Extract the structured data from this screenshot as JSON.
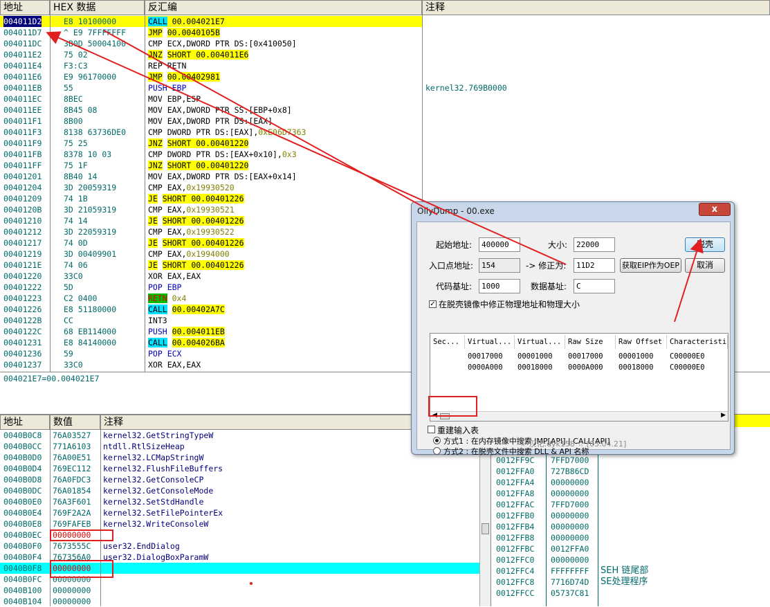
{
  "cpu": {
    "headers": {
      "addr": "地址",
      "hex": "HEX 数据",
      "dis": "反汇编",
      "cmt": "注释"
    },
    "rows": [
      {
        "addr": "004011D2",
        "hex": "E8 10100000",
        "op": "CALL",
        "opt": "call",
        "arg": "00.004021E7",
        "argt": "y",
        "cmt": ""
      },
      {
        "addr": "004011D7",
        "hex": "^ E9 7FFFFFFF",
        "op": "JMP",
        "opt": "red",
        "arg": "00.0040105B",
        "argt": "y",
        "cmt": ""
      },
      {
        "addr": "004011DC",
        "hex": "3B0D 50004100",
        "op": "CMP ECX,DWORD PTR DS:[0x410050]",
        "opt": "plain",
        "arg": "",
        "argt": "",
        "cmt": ""
      },
      {
        "addr": "004011E2",
        "hex": "75 02",
        "op": "JNZ",
        "opt": "red",
        "arg": "SHORT 00.004011E6",
        "argt": "y",
        "cmt": ""
      },
      {
        "addr": "004011E4",
        "hex": "F3:C3",
        "op": "REP RETN",
        "opt": "plain",
        "arg": "",
        "argt": "",
        "cmt": ""
      },
      {
        "addr": "004011E6",
        "hex": "E9 96170000",
        "op": "JMP",
        "opt": "red",
        "arg": "00.00402981",
        "argt": "y",
        "cmt": ""
      },
      {
        "addr": "004011EB",
        "hex": "55",
        "op": "PUSH EBP",
        "opt": "blue",
        "arg": "",
        "argt": "",
        "cmt": "kernel32.769B0000"
      },
      {
        "addr": "004011EC",
        "hex": "8BEC",
        "op": "MOV EBP,ESP",
        "opt": "plain",
        "arg": "",
        "argt": "",
        "cmt": ""
      },
      {
        "addr": "004011EE",
        "hex": "8B45 08",
        "op": "MOV EAX,DWORD PTR SS:[EBP+0x8]",
        "opt": "plain",
        "arg": "",
        "argt": "",
        "cmt": ""
      },
      {
        "addr": "004011F1",
        "hex": "8B00",
        "op": "MOV EAX,DWORD PTR DS:[EAX]",
        "opt": "plain",
        "arg": "",
        "argt": "",
        "cmt": ""
      },
      {
        "addr": "004011F3",
        "hex": "8138 63736DE0",
        "op": "CMP DWORD PTR DS:[EAX],",
        "opt": "plain",
        "arg": "0xE06D7363",
        "argt": "num",
        "cmt": ""
      },
      {
        "addr": "004011F9",
        "hex": "75 25",
        "op": "JNZ",
        "opt": "red",
        "arg": "SHORT 00.00401220",
        "argt": "y",
        "cmt": ""
      },
      {
        "addr": "004011FB",
        "hex": "8378 10 03",
        "op": "CMP DWORD PTR DS:[EAX+0x10],",
        "opt": "plain",
        "arg": "0x3",
        "argt": "num",
        "cmt": ""
      },
      {
        "addr": "004011FF",
        "hex": "75 1F",
        "op": "JNZ",
        "opt": "red",
        "arg": "SHORT 00.00401220",
        "argt": "y",
        "cmt": ""
      },
      {
        "addr": "00401201",
        "hex": "8B40 14",
        "op": "MOV EAX,DWORD PTR DS:[EAX+0x14]",
        "opt": "plain",
        "arg": "",
        "argt": "",
        "cmt": ""
      },
      {
        "addr": "00401204",
        "hex": "3D 20059319",
        "op": "CMP EAX,",
        "opt": "plain",
        "arg": "0x19930520",
        "argt": "num",
        "cmt": ""
      },
      {
        "addr": "00401209",
        "hex": "74 1B",
        "op": "JE",
        "opt": "red",
        "arg": "SHORT 00.00401226",
        "argt": "y",
        "cmt": ""
      },
      {
        "addr": "0040120B",
        "hex": "3D 21059319",
        "op": "CMP EAX,",
        "opt": "plain",
        "arg": "0x19930521",
        "argt": "num",
        "cmt": ""
      },
      {
        "addr": "00401210",
        "hex": "74 14",
        "op": "JE",
        "opt": "red",
        "arg": "SHORT 00.00401226",
        "argt": "y",
        "cmt": ""
      },
      {
        "addr": "00401212",
        "hex": "3D 22059319",
        "op": "CMP EAX,",
        "opt": "plain",
        "arg": "0x19930522",
        "argt": "num",
        "cmt": ""
      },
      {
        "addr": "00401217",
        "hex": "74 0D",
        "op": "JE",
        "opt": "red",
        "arg": "SHORT 00.00401226",
        "argt": "y",
        "cmt": ""
      },
      {
        "addr": "00401219",
        "hex": "3D 00409901",
        "op": "CMP EAX,",
        "opt": "plain",
        "arg": "0x1994000",
        "argt": "num",
        "cmt": ""
      },
      {
        "addr": "0040121E",
        "hex": "74 06",
        "op": "JE",
        "opt": "red",
        "arg": "SHORT 00.00401226",
        "argt": "y",
        "cmt": ""
      },
      {
        "addr": "00401220",
        "hex": "33C0",
        "op": "XOR EAX,EAX",
        "opt": "plain",
        "arg": "",
        "argt": "",
        "cmt": ""
      },
      {
        "addr": "00401222",
        "hex": "5D",
        "op": "POP EBP",
        "opt": "blue",
        "arg": "",
        "argt": "",
        "cmt": ""
      },
      {
        "addr": "00401223",
        "hex": "C2 0400",
        "op": "RETN",
        "opt": "retn",
        "arg": " 0x4",
        "argt": "num",
        "cmt": ""
      },
      {
        "addr": "00401226",
        "hex": "E8 51180000",
        "op": "CALL",
        "opt": "call",
        "arg": "00.00402A7C",
        "argt": "y",
        "cmt": ""
      },
      {
        "addr": "0040122B",
        "hex": "CC",
        "op": "INT3",
        "opt": "plain",
        "arg": "",
        "argt": "",
        "cmt": ""
      },
      {
        "addr": "0040122C",
        "hex": "68 EB114000",
        "op": "PUSH",
        "opt": "blue",
        "arg": "00.004011EB",
        "argt": "y",
        "cmt": ""
      },
      {
        "addr": "00401231",
        "hex": "E8 84140000",
        "op": "CALL",
        "opt": "call",
        "arg": "00.004026BA",
        "argt": "y",
        "cmt": ""
      },
      {
        "addr": "00401236",
        "hex": "59",
        "op": "POP ECX",
        "opt": "blue",
        "arg": "",
        "argt": "",
        "cmt": ""
      },
      {
        "addr": "00401237",
        "hex": "33C0",
        "op": "XOR EAX,EAX",
        "opt": "plain",
        "arg": "",
        "argt": "",
        "cmt": ""
      }
    ]
  },
  "info": {
    "text": "004021E7=00.004021E7"
  },
  "dump": {
    "headers": {
      "addr": "地址",
      "val": "数值",
      "cmt": "注释"
    },
    "rows": [
      {
        "addr": "0040B0C8",
        "val": "76A03527",
        "cmt": "kernel32.GetStringTypeW"
      },
      {
        "addr": "0040B0CC",
        "val": "771A6103",
        "cmt": "ntdll.RtlSizeHeap"
      },
      {
        "addr": "0040B0D0",
        "val": "76A00E51",
        "cmt": "kernel32.LCMapStringW"
      },
      {
        "addr": "0040B0D4",
        "val": "769EC112",
        "cmt": "kernel32.FlushFileBuffers"
      },
      {
        "addr": "0040B0D8",
        "val": "76A0FDC3",
        "cmt": "kernel32.GetConsoleCP"
      },
      {
        "addr": "0040B0DC",
        "val": "76A01854",
        "cmt": "kernel32.GetConsoleMode"
      },
      {
        "addr": "0040B0E0",
        "val": "76A3F601",
        "cmt": "kernel32.SetStdHandle"
      },
      {
        "addr": "0040B0E4",
        "val": "769F2A2A",
        "cmt": "kernel32.SetFilePointerEx"
      },
      {
        "addr": "0040B0E8",
        "val": "769FAFEB",
        "cmt": "kernel32.WriteConsoleW"
      },
      {
        "addr": "0040B0EC",
        "val": "00000000",
        "cmt": ""
      },
      {
        "addr": "0040B0F0",
        "val": "7673555C",
        "cmt": "user32.EndDialog"
      },
      {
        "addr": "0040B0F4",
        "val": "767356A0",
        "cmt": "user32.DialogBoxParamW"
      },
      {
        "addr": "0040B0F8",
        "val": "00000000",
        "cmt": ""
      },
      {
        "addr": "0040B0FC",
        "val": "00000000",
        "cmt": ""
      },
      {
        "addr": "0040B100",
        "val": "00000000",
        "cmt": ""
      },
      {
        "addr": "0040B104",
        "val": "00000000",
        "cmt": ""
      }
    ]
  },
  "stack": {
    "rows": [
      {
        "addr": "0012FF9C",
        "val": "7FFD7000",
        "cmt": ""
      },
      {
        "addr": "0012FFA0",
        "val": "727B86CD",
        "cmt": ""
      },
      {
        "addr": "0012FFA4",
        "val": "00000000",
        "cmt": ""
      },
      {
        "addr": "0012FFA8",
        "val": "00000000",
        "cmt": ""
      },
      {
        "addr": "0012FFAC",
        "val": "7FFD7000",
        "cmt": ""
      },
      {
        "addr": "0012FFB0",
        "val": "00000000",
        "cmt": ""
      },
      {
        "addr": "0012FFB4",
        "val": "00000000",
        "cmt": ""
      },
      {
        "addr": "0012FFB8",
        "val": "00000000",
        "cmt": ""
      },
      {
        "addr": "0012FFBC",
        "val": "0012FFA0",
        "cmt": ""
      },
      {
        "addr": "0012FFC0",
        "val": "00000000",
        "cmt": ""
      },
      {
        "addr": "0012FFC4",
        "val": "FFFFFFFF",
        "cmt": "SEH 链尾部"
      },
      {
        "addr": "0012FFC8",
        "val": "7716D74D",
        "cmt": "SE处理程序"
      },
      {
        "addr": "0012FFCC",
        "val": "05737C81",
        "cmt": ""
      }
    ]
  },
  "dialog": {
    "title": "OllyDump - 00.exe",
    "close": "x",
    "start_label": "起始地址:",
    "start_value": "400000",
    "size_label": "大小:",
    "size_value": "22000",
    "dump_button": "脱壳",
    "ep_label": "入口点地址:",
    "ep_value": "154",
    "fix_label": "-> 修正为:",
    "fix_value": "11D2",
    "geteip_button": "获取EIP作为OEP",
    "cancel_button": "取消",
    "code_label": "代码基址:",
    "code_value": "1000",
    "data_label": "数据基址:",
    "data_value": "C",
    "fix_check": "在脱壳镜像中修正物理地址和物理大小",
    "columns": [
      "Sec...",
      "Virtual...",
      "Virtual...",
      "Raw Size",
      "Raw Offset",
      "Characteristic"
    ],
    "sections": [
      [
        "",
        "00017000",
        "00001000",
        "00017000",
        "00001000",
        "C00000E0"
      ],
      [
        "",
        "0000A000",
        "00018000",
        "0000A000",
        "00018000",
        "C00000E0"
      ]
    ],
    "rebuild_check": "重建输入表",
    "method1": "方式1 : 在内存镜像中搜索 JMP[API] | CALL[API]",
    "method2": "方式2 : 在脱壳文件中搜索 DLL & API 名称",
    "credit": "☆ 汉化:dyk158 ☆ [05.04.21]"
  }
}
